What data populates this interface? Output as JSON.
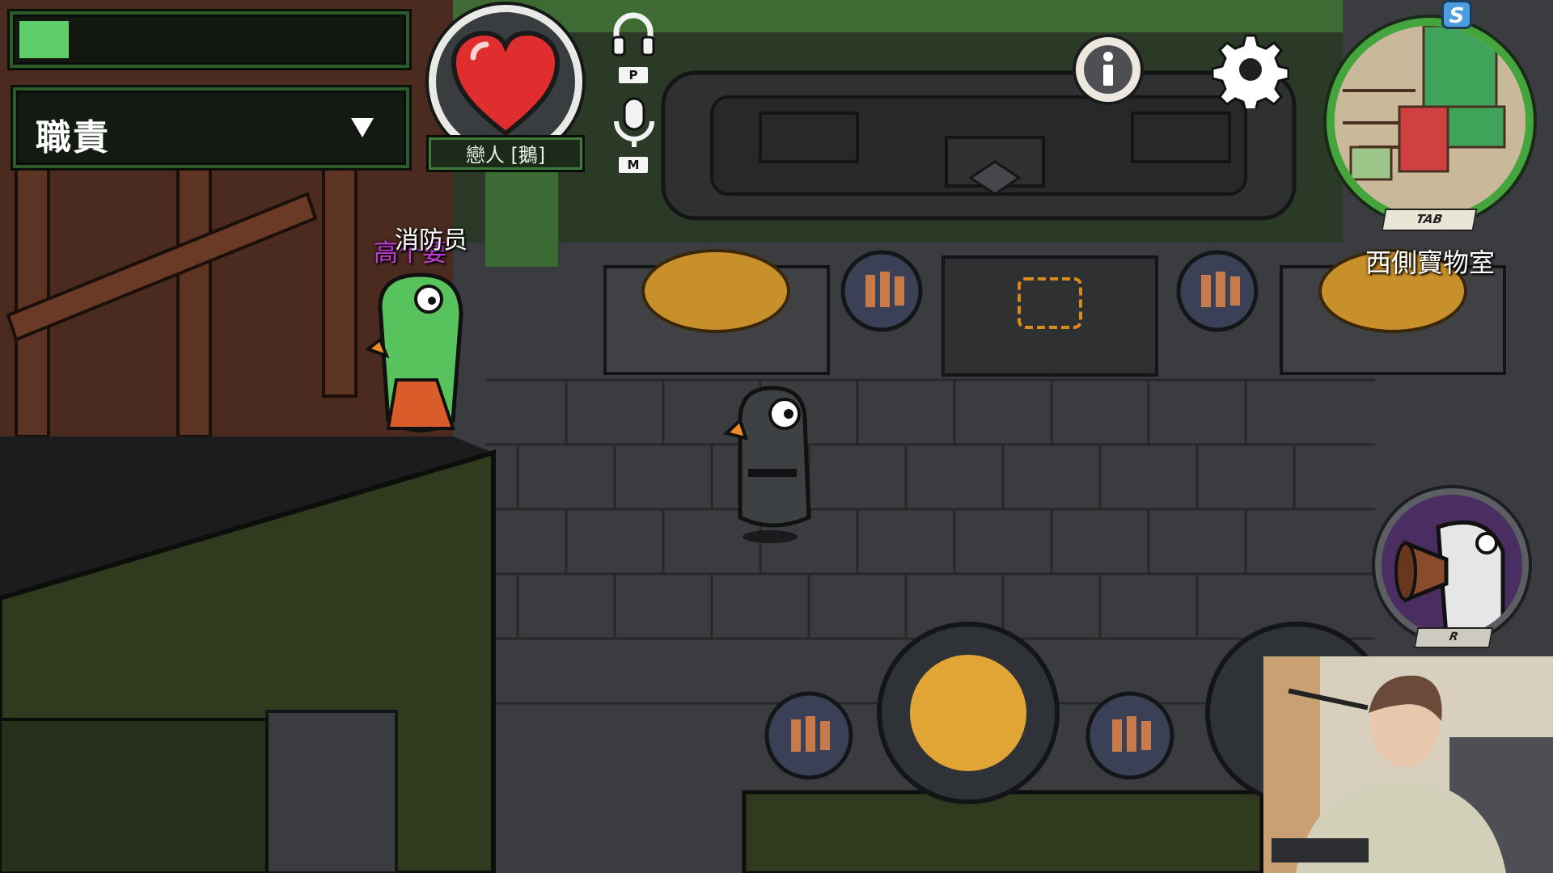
{
  "hud": {
    "task_progress": 0.13,
    "task_dropdown_label": "職責",
    "role_label": "戀人 [鵝]",
    "headphones_key": "P",
    "mic_key": "M"
  },
  "minimap": {
    "badge_letter": "S",
    "tab_key": "TAB",
    "room_name": "西側寶物室"
  },
  "ability": {
    "key": "R"
  },
  "players": {
    "left_role_tag": "消防员",
    "left_name_tag": "高个要"
  },
  "colors": {
    "progress_fill": "#5fcd6a",
    "hud_frame": "#2d5a2a",
    "heart": "#e02d2d",
    "minimap_ring": "#43a53b",
    "ability_bg": "#4b2e61"
  },
  "icons": [
    "headphones-icon",
    "microphone-icon",
    "heart-icon",
    "info-icon",
    "gear-icon",
    "megaphone-goose-icon"
  ]
}
